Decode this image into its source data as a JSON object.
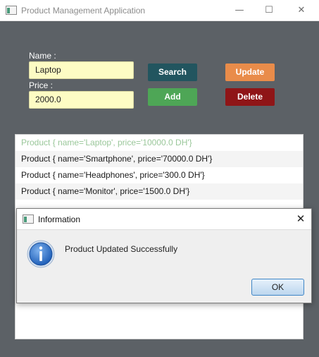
{
  "window": {
    "title": "Product Management Application",
    "controls": {
      "minimize": "—",
      "maximize": "☐",
      "close": "✕"
    }
  },
  "form": {
    "name_label": "Name :",
    "name_value": "Laptop",
    "price_label": "Price :",
    "price_value": "2000.0"
  },
  "buttons": {
    "search": "Search",
    "add": "Add",
    "update": "Update",
    "delete": "Delete"
  },
  "products": [
    {
      "text": "Product { name='Laptop', price='10000.0 DH'}",
      "selected": true
    },
    {
      "text": "Product { name='Smartphone', price='70000.0 DH'}",
      "selected": false
    },
    {
      "text": "Product { name='Headphones', price='300.0 DH'}",
      "selected": false
    },
    {
      "text": "Product { name='Monitor', price='1500.0 DH'}",
      "selected": false
    }
  ],
  "dialog": {
    "title": "Information",
    "close": "✕",
    "message": "Product Updated Successfully",
    "ok_label": "OK"
  },
  "colors": {
    "background": "#5c6166",
    "search": "#22555f",
    "add": "#4ea656",
    "update": "#e98c4a",
    "delete": "#8f1517",
    "input": "#fdfcc4",
    "info_icon": "#2b6cc4"
  }
}
